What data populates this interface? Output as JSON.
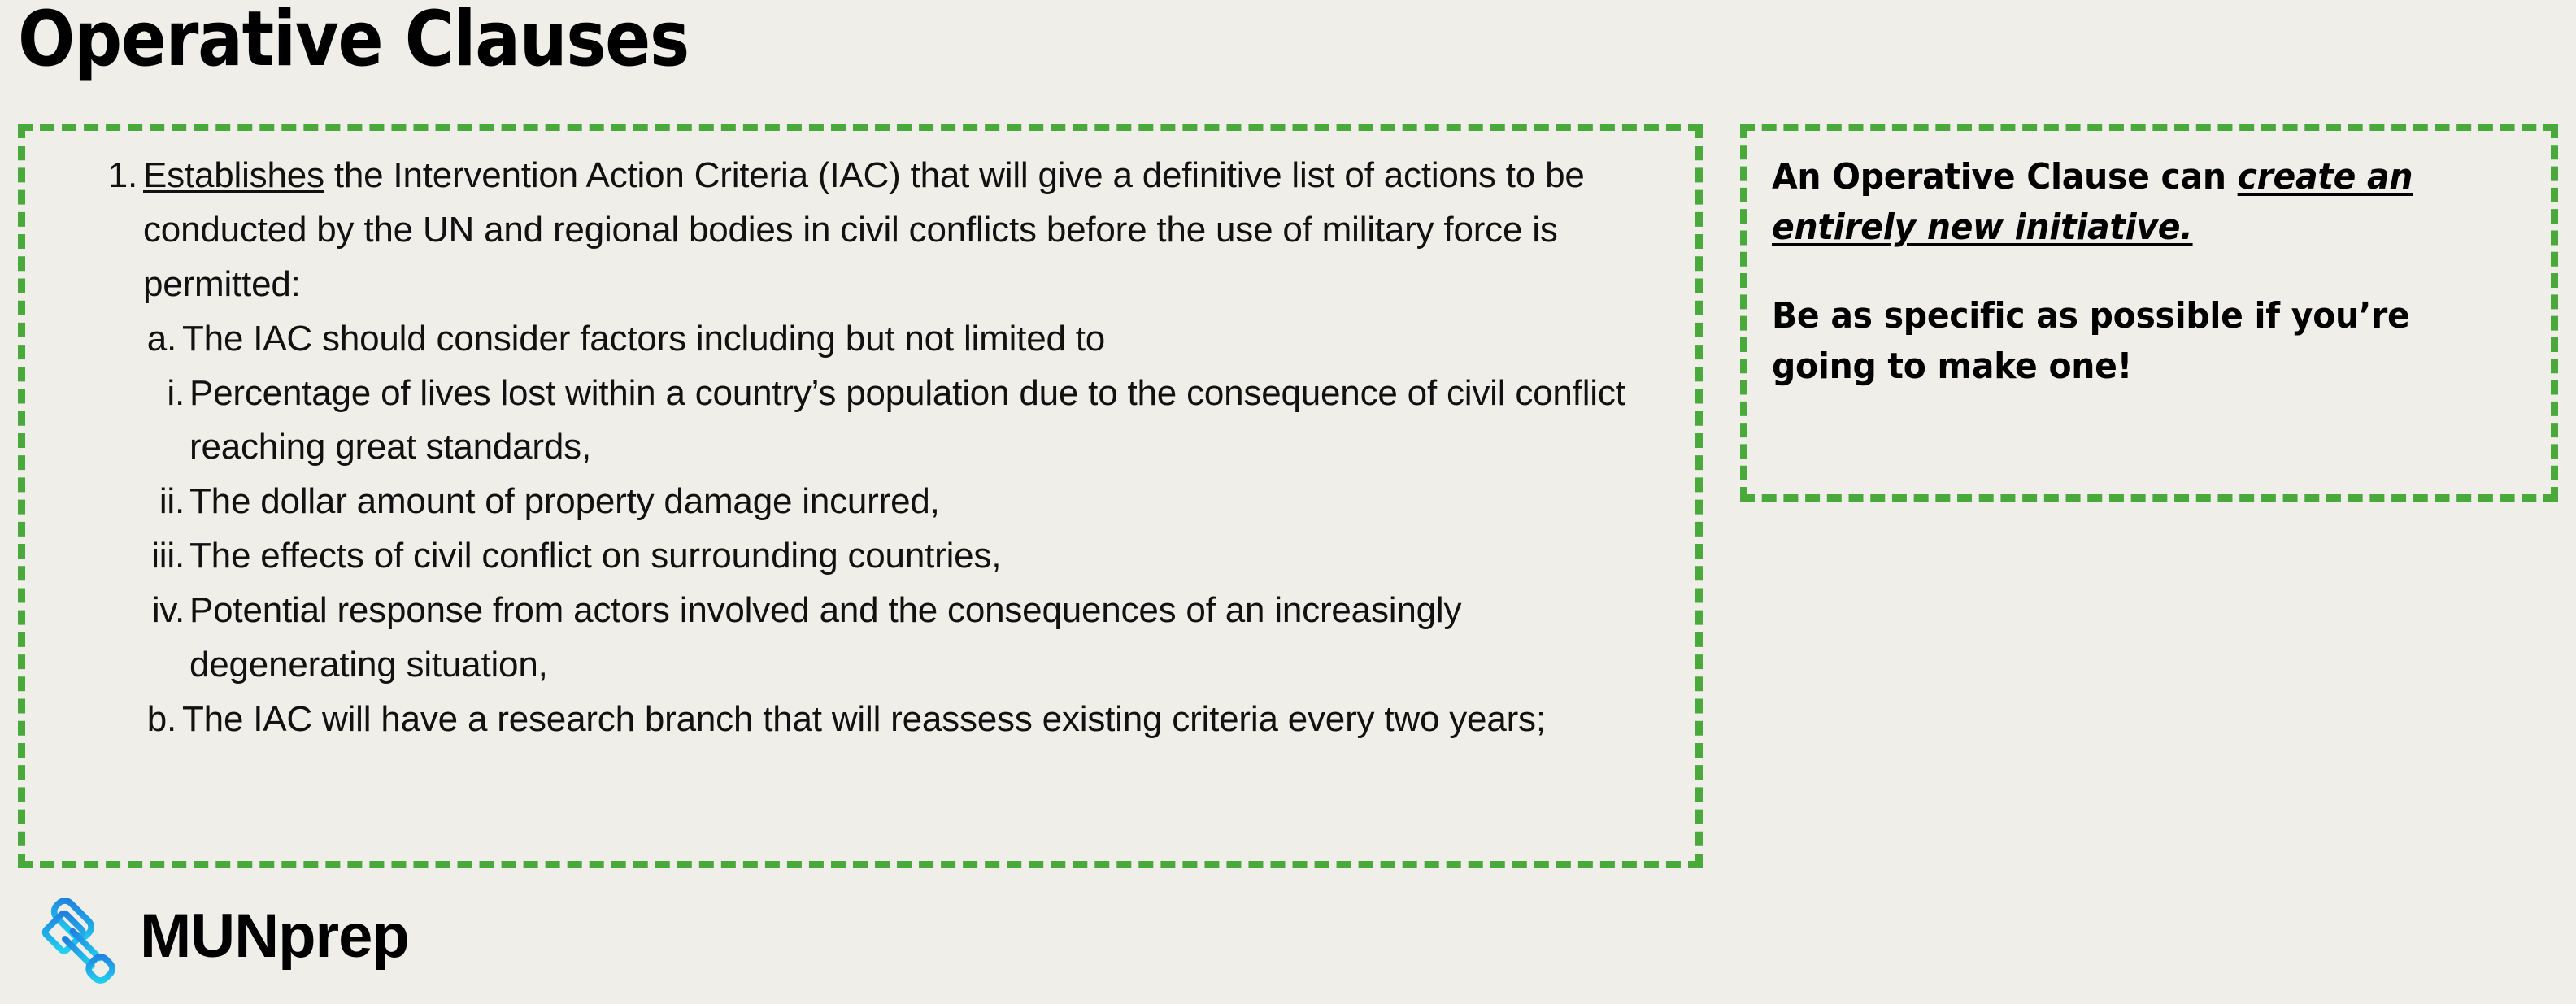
{
  "page": {
    "title": "Operative Clauses",
    "background_color": "#F0EEE8",
    "accent_color": "#4AA93B",
    "text_color": "#111111"
  },
  "clause_box": {
    "items": [
      {
        "marker": "1.",
        "lead_underlined": "Establishes",
        "text": " the Intervention Action Criteria (IAC) that will give a definitive list of actions to be conducted by the UN and regional bodies in civil conflicts before the use of military force is permitted:"
      },
      {
        "marker": "a.",
        "text": "The IAC should consider factors including but not limited to"
      },
      {
        "marker": "i.",
        "text": "Percentage of lives lost within a country’s population due to the consequence of civil conflict reaching great standards,"
      },
      {
        "marker": "ii.",
        "text": "The dollar amount of property damage incurred,"
      },
      {
        "marker": "iii.",
        "text": "The effects of civil conflict on surrounding countries,"
      },
      {
        "marker": "iv.",
        "text": "Potential response from actors involved and the consequences of an increasingly degenerating situation,"
      },
      {
        "marker": "b.",
        "text": "The IAC will have a research branch that will reassess existing criteria every two years;"
      }
    ]
  },
  "tip_box": {
    "para1_lead": "An Operative Clause can ",
    "para1_emphasis": "create an entirely new initiative. ",
    "para2": "Be as specific as possible if you’re going to make one!"
  },
  "logo": {
    "icon": "gavel-icon",
    "text": "MUNprep",
    "icon_gradient_start": "#1F7FE0",
    "icon_gradient_end": "#22D3F0"
  }
}
